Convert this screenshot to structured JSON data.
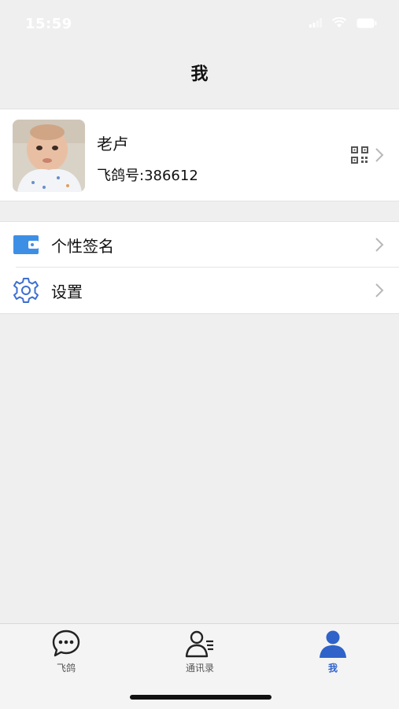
{
  "status_bar": {
    "time": "15:59"
  },
  "header": {
    "title": "我"
  },
  "profile": {
    "name": "老卢",
    "id_label": "飞鸽号:386612"
  },
  "menu": {
    "items": [
      {
        "label": "个性签名",
        "icon": "wallet-icon"
      },
      {
        "label": "设置",
        "icon": "gear-icon"
      }
    ]
  },
  "tab_bar": {
    "tabs": [
      {
        "label": "飞鸽",
        "icon": "chat-bubble-icon",
        "active": false
      },
      {
        "label": "通讯录",
        "icon": "contacts-icon",
        "active": false
      },
      {
        "label": "我",
        "icon": "person-icon",
        "active": true
      }
    ],
    "active_color": "#2f63c9"
  },
  "colors": {
    "background": "#efefef",
    "card": "#ffffff",
    "accent": "#3d8fe5"
  }
}
